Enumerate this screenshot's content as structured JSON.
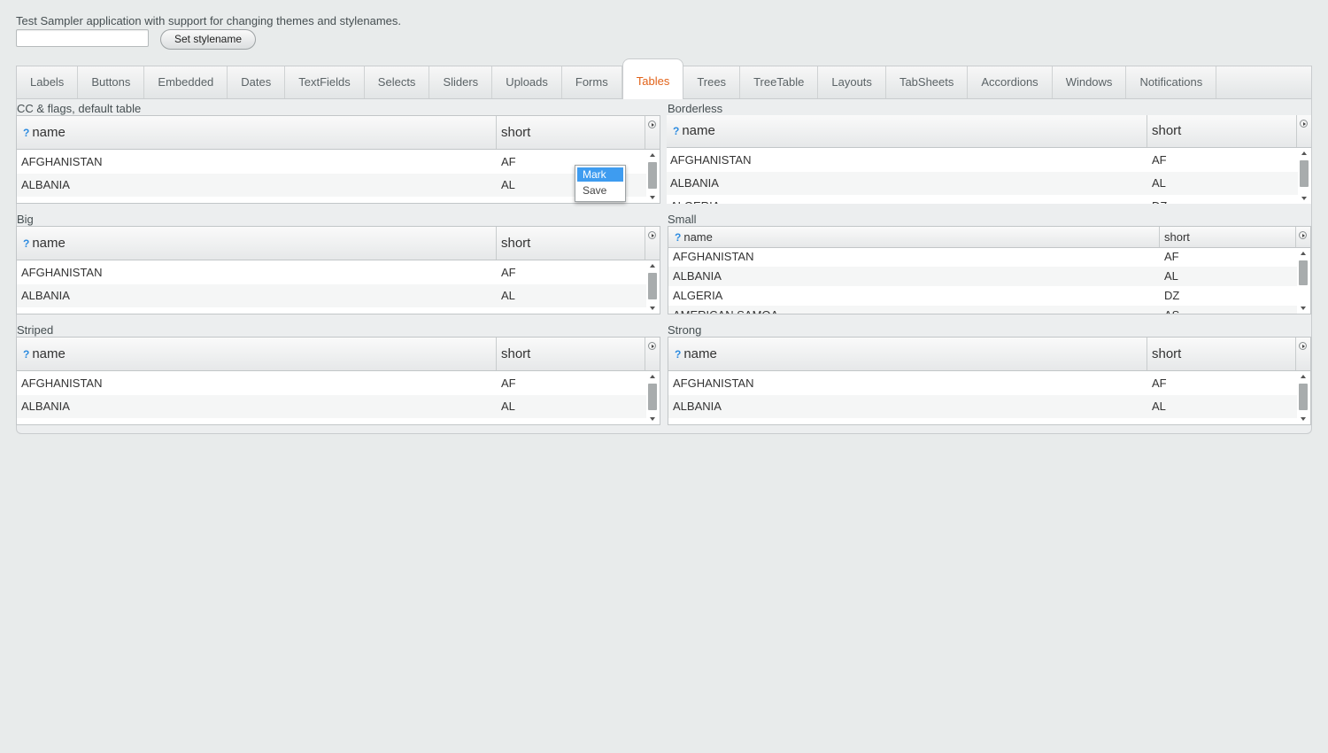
{
  "intro_text": "Test Sampler application with support for changing themes and stylenames.",
  "stylename_input": {
    "value": "",
    "placeholder": ""
  },
  "set_stylename_label": "Set stylename",
  "tabs": [
    {
      "label": "Labels",
      "selected": false
    },
    {
      "label": "Buttons",
      "selected": false
    },
    {
      "label": "Embedded",
      "selected": false
    },
    {
      "label": "Dates",
      "selected": false
    },
    {
      "label": "TextFields",
      "selected": false
    },
    {
      "label": "Selects",
      "selected": false
    },
    {
      "label": "Sliders",
      "selected": false
    },
    {
      "label": "Uploads",
      "selected": false
    },
    {
      "label": "Forms",
      "selected": false
    },
    {
      "label": "Tables",
      "selected": true
    },
    {
      "label": "Trees",
      "selected": false
    },
    {
      "label": "TreeTable",
      "selected": false
    },
    {
      "label": "Layouts",
      "selected": false
    },
    {
      "label": "TabSheets",
      "selected": false
    },
    {
      "label": "Accordions",
      "selected": false
    },
    {
      "label": "Windows",
      "selected": false
    },
    {
      "label": "Notifications",
      "selected": false
    }
  ],
  "tables": {
    "default": {
      "caption": "CC & flags, default table",
      "columns": [
        "name",
        "short"
      ],
      "rows": [
        [
          "AFGHANISTAN",
          "AF"
        ],
        [
          "ALBANIA",
          "AL"
        ]
      ]
    },
    "borderless": {
      "caption": "Borderless",
      "columns": [
        "name",
        "short"
      ],
      "rows": [
        [
          "AFGHANISTAN",
          "AF"
        ],
        [
          "ALBANIA",
          "AL"
        ],
        [
          "ALGERIA",
          "DZ"
        ]
      ]
    },
    "big": {
      "caption": "Big",
      "columns": [
        "name",
        "short"
      ],
      "rows": [
        [
          "AFGHANISTAN",
          "AF"
        ],
        [
          "ALBANIA",
          "AL"
        ]
      ]
    },
    "small": {
      "caption": "Small",
      "columns": [
        "name",
        "short"
      ],
      "rows": [
        [
          "AFGHANISTAN",
          "AF"
        ],
        [
          "ALBANIA",
          "AL"
        ],
        [
          "ALGERIA",
          "DZ"
        ],
        [
          "AMERICAN SAMOA",
          "AS"
        ]
      ]
    },
    "striped": {
      "caption": "Striped",
      "columns": [
        "name",
        "short"
      ],
      "rows": [
        [
          "AFGHANISTAN",
          "AF"
        ],
        [
          "ALBANIA",
          "AL"
        ]
      ]
    },
    "strong": {
      "caption": "Strong",
      "columns": [
        "name",
        "short"
      ],
      "rows": [
        [
          "AFGHANISTAN",
          "AF"
        ],
        [
          "ALBANIA",
          "AL"
        ]
      ]
    }
  },
  "context_menu": {
    "items": [
      {
        "label": "Mark",
        "highlighted": true
      },
      {
        "label": "Save",
        "highlighted": false
      }
    ]
  },
  "help_icon_glyph": "?",
  "colors": {
    "accent": "#e2631a",
    "menu_highlight": "#3e9cf0",
    "help_icon": "#2e8ce0"
  }
}
